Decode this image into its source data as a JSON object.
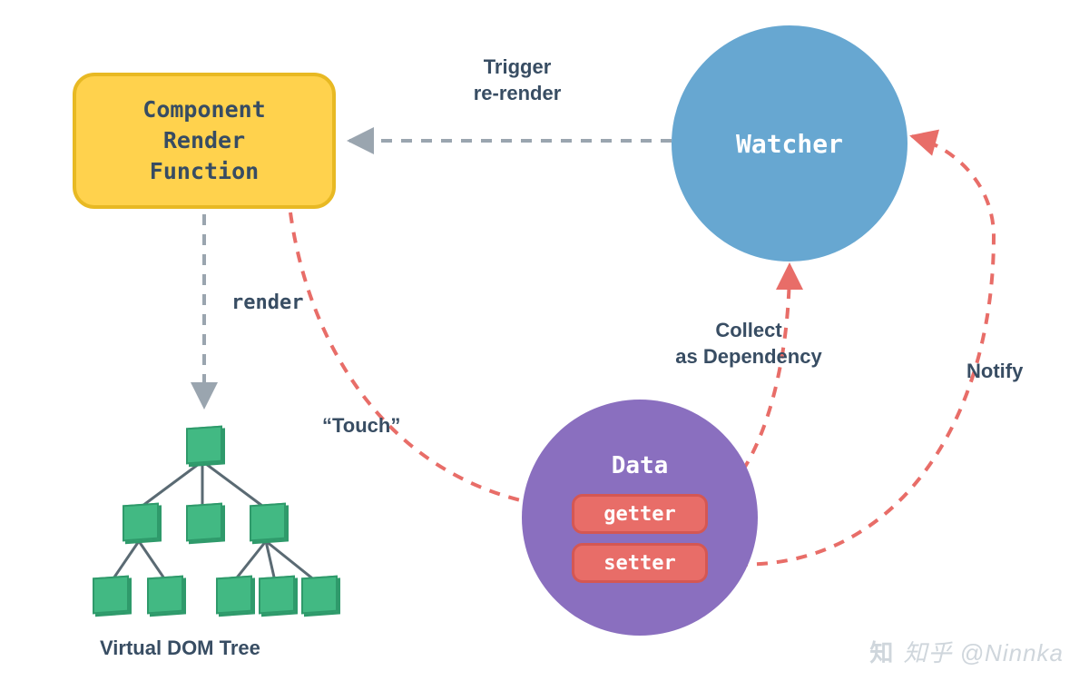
{
  "nodes": {
    "componentRenderFunction": "Component\nRender\nFunction",
    "watcher": "Watcher",
    "data": {
      "title": "Data",
      "getter": "getter",
      "setter": "setter"
    },
    "virtualDomTree": "Virtual DOM Tree"
  },
  "edges": {
    "triggerRerender": "Trigger\nre-render",
    "render": "render",
    "touch": "“Touch”",
    "collectAsDependency": "Collect\nas Dependency",
    "notify": "Notify"
  },
  "colors": {
    "boxFill": "#ffd24d",
    "boxBorder": "#e8b923",
    "watcherFill": "#67a7d1",
    "dataFill": "#8a6fbf",
    "pillFill": "#e86d68",
    "pillBorder": "#d45753",
    "cubeFill": "#42b983",
    "cubeBorder": "#2f9a6b",
    "grayArrow": "#9aa5af",
    "redArrow": "#e86d68",
    "text": "#384d63"
  },
  "watermark": "知乎 @Ninnka"
}
